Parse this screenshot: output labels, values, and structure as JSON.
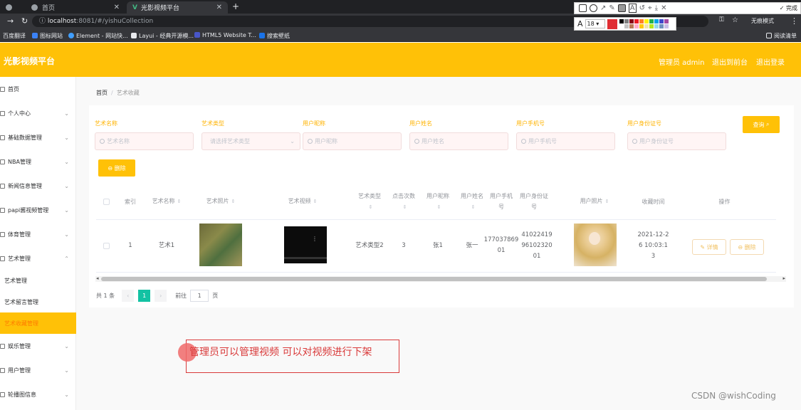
{
  "browser": {
    "tabs": [
      {
        "label": "首页"
      },
      {
        "label": "光影视频平台"
      }
    ],
    "url_host": "localhost",
    "url_rest": ":8081/#/yishuCollection",
    "incognito_label": "无痕模式",
    "reading_list": "阅读清单",
    "bookmarks": [
      "百度翻译",
      "图标网站",
      "Element - 网站快...",
      "Layui - 经典开源模...",
      "HTML5 Website T...",
      "搜索壁纸"
    ],
    "snip_tool": {
      "done_label": "完成",
      "font_size": "18",
      "current_color": "#e02d33",
      "palette": [
        "#000000",
        "#7f7f7f",
        "#880015",
        "#ed1c24",
        "#ff7f27",
        "#fff200",
        "#22b14c",
        "#00a2e8",
        "#3f48cc",
        "#a349a4",
        "#ffffff",
        "#c3c3c3",
        "#b97a57",
        "#ffaec9",
        "#ffc90e",
        "#efe4b0",
        "#b5e61d",
        "#99d9ea",
        "#7092be",
        "#c8bfe7"
      ]
    }
  },
  "header": {
    "title": "光影视频平台",
    "user": "管理员 admin",
    "front_link": "退出到前台",
    "logout": "退出登录",
    "accent": "#ffc107"
  },
  "sidebar": {
    "items": [
      {
        "label": "首页",
        "has_children": false
      },
      {
        "label": "个人中心",
        "has_children": true
      },
      {
        "label": "基础数据管理",
        "has_children": true
      },
      {
        "label": "NBA管理",
        "has_children": true
      },
      {
        "label": "新闻信息管理",
        "has_children": true
      },
      {
        "label": "papi酱视频管理",
        "has_children": true
      },
      {
        "label": "体育管理",
        "has_children": true
      },
      {
        "label": "艺术管理",
        "has_children": true
      }
    ],
    "sub_items": [
      {
        "label": "艺术管理",
        "active": false
      },
      {
        "label": "艺术留言管理",
        "active": false
      },
      {
        "label": "艺术收藏管理",
        "active": true
      }
    ],
    "after_items": [
      {
        "label": "娱乐管理"
      },
      {
        "label": "用户管理"
      },
      {
        "label": "轮播图信息"
      }
    ]
  },
  "breadcrumb": {
    "home": "首页",
    "current": "艺术收藏"
  },
  "filters": [
    {
      "label": "艺术名称",
      "placeholder": "艺术名称",
      "type": "input"
    },
    {
      "label": "艺术类型",
      "placeholder": "请选择艺术类型",
      "type": "select"
    },
    {
      "label": "用户昵称",
      "placeholder": "用户昵称",
      "type": "input"
    },
    {
      "label": "用户姓名",
      "placeholder": "用户姓名",
      "type": "input"
    },
    {
      "label": "用户手机号",
      "placeholder": "用户手机号",
      "type": "input"
    },
    {
      "label": "用户身份证号",
      "placeholder": "用户身份证号",
      "type": "input"
    }
  ],
  "search_button": "查询",
  "delete_button": "删除",
  "table": {
    "columns": [
      "索引",
      "艺术名称",
      "艺术照片",
      "艺术视频",
      "艺术类型",
      "点击次数",
      "用户昵称",
      "用户姓名",
      "用户手机号",
      "用户身份证号",
      "用户照片",
      "收藏时间",
      "操作"
    ],
    "rows": [
      {
        "index": "1",
        "name": "艺术1",
        "type": "艺术类型2",
        "clicks": "3",
        "nickname": "张1",
        "realname": "张一",
        "phone": "17703786901",
        "idcard": "410224199610232001",
        "time": "2021-12-26 10:03:13",
        "details_label": "详情",
        "delete_label": "删除"
      }
    ]
  },
  "pagination": {
    "total": "共 1 条",
    "current_page": "1",
    "goto_label": "前往",
    "goto_value": "1",
    "page_unit": "页"
  },
  "annotation": {
    "text": "管理员可以管理视频 可以对视频进行下架",
    "color": "#d93a3a"
  },
  "watermark": "CSDN @wishCoding"
}
